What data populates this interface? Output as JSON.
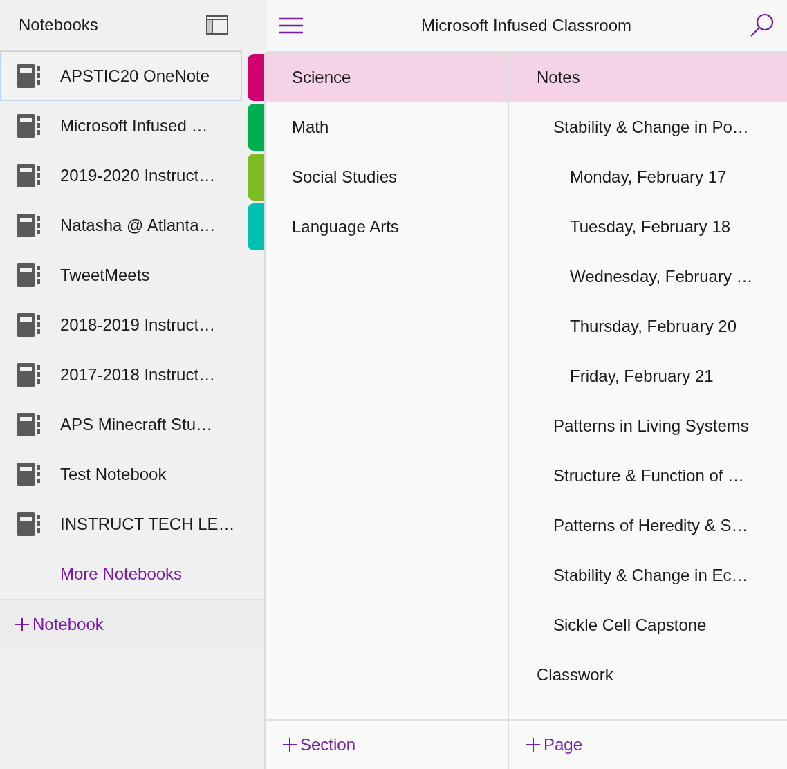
{
  "sidebar": {
    "title": "Notebooks",
    "notebooks": [
      {
        "name": "APSTIC20 OneNote",
        "selected": true
      },
      {
        "name": "Microsoft Infused …",
        "selected": false
      },
      {
        "name": "2019-2020 Instruct…",
        "selected": false
      },
      {
        "name": "Natasha @ Atlanta…",
        "selected": false
      },
      {
        "name": "TweetMeets",
        "selected": false
      },
      {
        "name": "2018-2019 Instruct…",
        "selected": false
      },
      {
        "name": "2017-2018 Instruct…",
        "selected": false
      },
      {
        "name": "APS Minecraft Stu…",
        "selected": false
      },
      {
        "name": "Test Notebook",
        "selected": false
      },
      {
        "name": "INSTRUCT TECH LE…",
        "selected": false
      }
    ],
    "more_link": "More Notebooks",
    "add_button": "Notebook"
  },
  "header": {
    "title": "Microsoft Infused Classroom"
  },
  "sections": {
    "items": [
      {
        "name": "Science",
        "color": "#d0006f",
        "selected": true
      },
      {
        "name": "Math",
        "color": "#00b050",
        "selected": false
      },
      {
        "name": "Social Studies",
        "color": "#7fbc24",
        "selected": false
      },
      {
        "name": "Language Arts",
        "color": "#00c0b4",
        "selected": false
      }
    ],
    "add_button": "Section"
  },
  "pages": {
    "items": [
      {
        "title": "Notes",
        "selected": true,
        "children": [
          {
            "title": "Stability & Change in Po…",
            "selected": false,
            "children": [
              {
                "title": "Monday, February 17",
                "selected": false
              },
              {
                "title": "Tuesday, February 18",
                "selected": false
              },
              {
                "title": "Wednesday, February …",
                "selected": false
              },
              {
                "title": "Thursday, February 20",
                "selected": false
              },
              {
                "title": "Friday, February 21",
                "selected": false
              }
            ]
          },
          {
            "title": "Patterns in Living Systems",
            "selected": false
          },
          {
            "title": "Structure & Function of …",
            "selected": false
          },
          {
            "title": "Patterns of Heredity & S…",
            "selected": false
          },
          {
            "title": "Stability & Change in Ec…",
            "selected": false
          },
          {
            "title": "Sickle Cell Capstone",
            "selected": false
          }
        ]
      },
      {
        "title": "Classwork",
        "selected": false
      }
    ],
    "add_button": "Page"
  }
}
